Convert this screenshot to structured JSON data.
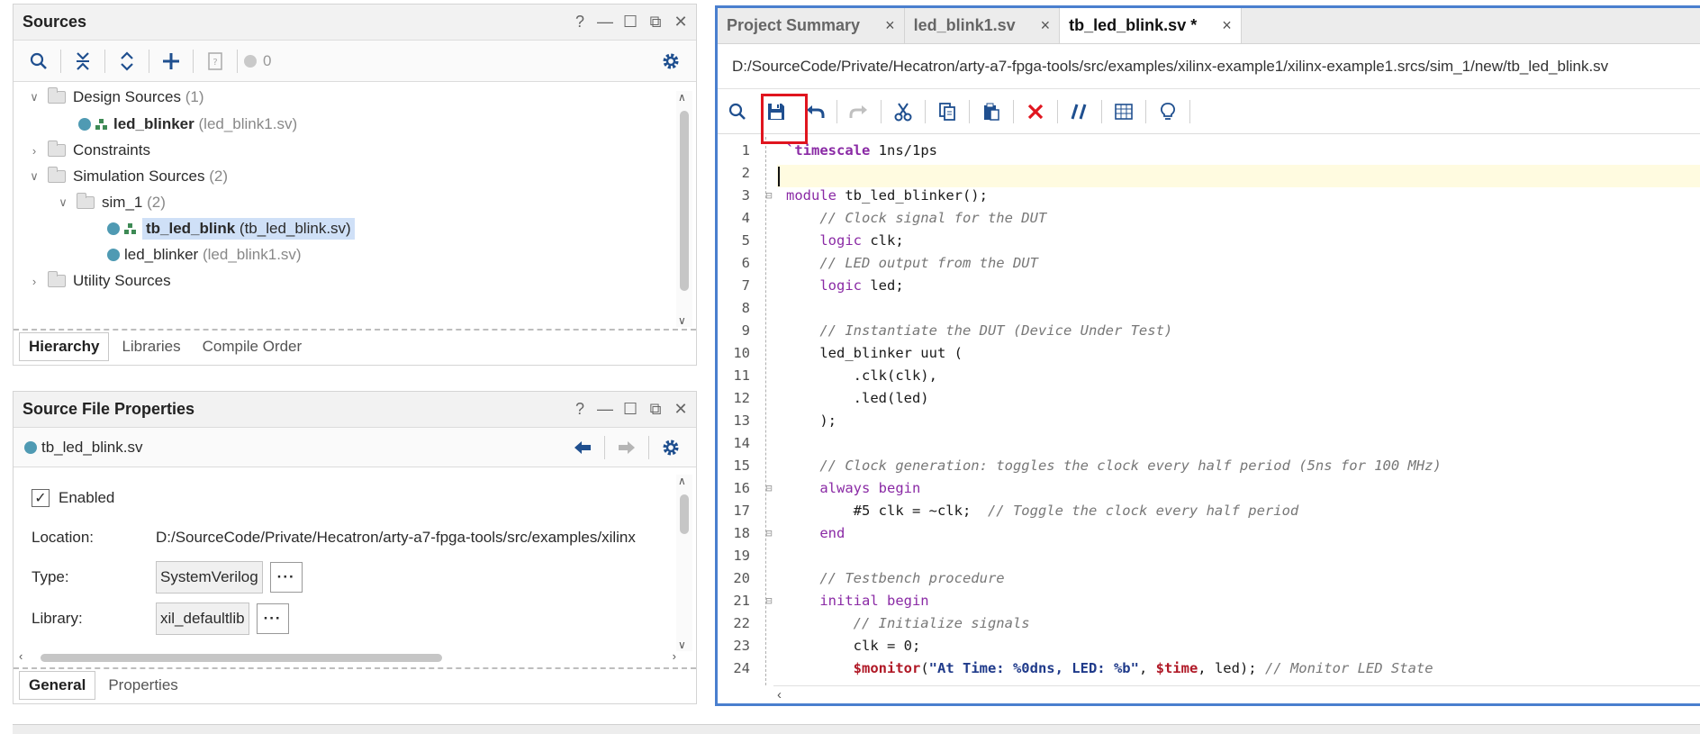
{
  "sources_panel": {
    "title": "Sources",
    "toolbar": {
      "badge_count": "0"
    },
    "tree": [
      {
        "label": "Design Sources",
        "count": "(1)"
      },
      {
        "label": "led_blinker",
        "file": "(led_blink1.sv)"
      },
      {
        "label": "Constraints"
      },
      {
        "label": "Simulation Sources",
        "count": "(2)"
      },
      {
        "label": "sim_1",
        "count": "(2)"
      },
      {
        "label": "tb_led_blink",
        "file": "(tb_led_blink.sv)"
      },
      {
        "label": "led_blinker",
        "file": "(led_blink1.sv)"
      },
      {
        "label": "Utility Sources"
      }
    ],
    "tabs": [
      "Hierarchy",
      "Libraries",
      "Compile Order"
    ]
  },
  "properties_panel": {
    "title": "Source File Properties",
    "file_name": "tb_led_blink.sv",
    "enabled_label": "Enabled",
    "location_label": "Location:",
    "location_value": "D:/SourceCode/Private/Hecatron/arty-a7-fpga-tools/src/examples/xilinx",
    "type_label": "Type:",
    "type_value": "SystemVerilog",
    "library_label": "Library:",
    "library_value": "xil_defaultlib",
    "dots": "···",
    "tabs": [
      "General",
      "Properties"
    ]
  },
  "editor": {
    "tabs": [
      "Project Summary",
      "led_blink1.sv",
      "tb_led_blink.sv *"
    ],
    "tab_close": "×",
    "file_path": "D:/SourceCode/Private/Hecatron/arty-a7-fpga-tools/src/examples/xilinx-example1/xilinx-example1.srcs/sim_1/new/tb_led_blink.sv",
    "line_numbers": [
      "1",
      "2",
      "3",
      "4",
      "5",
      "6",
      "7",
      "8",
      "9",
      "10",
      "11",
      "12",
      "13",
      "14",
      "15",
      "16",
      "17",
      "18",
      "19",
      "20",
      "21",
      "22",
      "23",
      "24"
    ]
  },
  "window_controls": {
    "help": "?",
    "minimize": "—",
    "maximize": "☐",
    "float": "⧉",
    "close": "✕"
  },
  "colors": {
    "accent": "#4a7fce",
    "highlight": "#e0151f",
    "file_dot": "#4f9ab3",
    "selection": "#cfe0f7"
  }
}
